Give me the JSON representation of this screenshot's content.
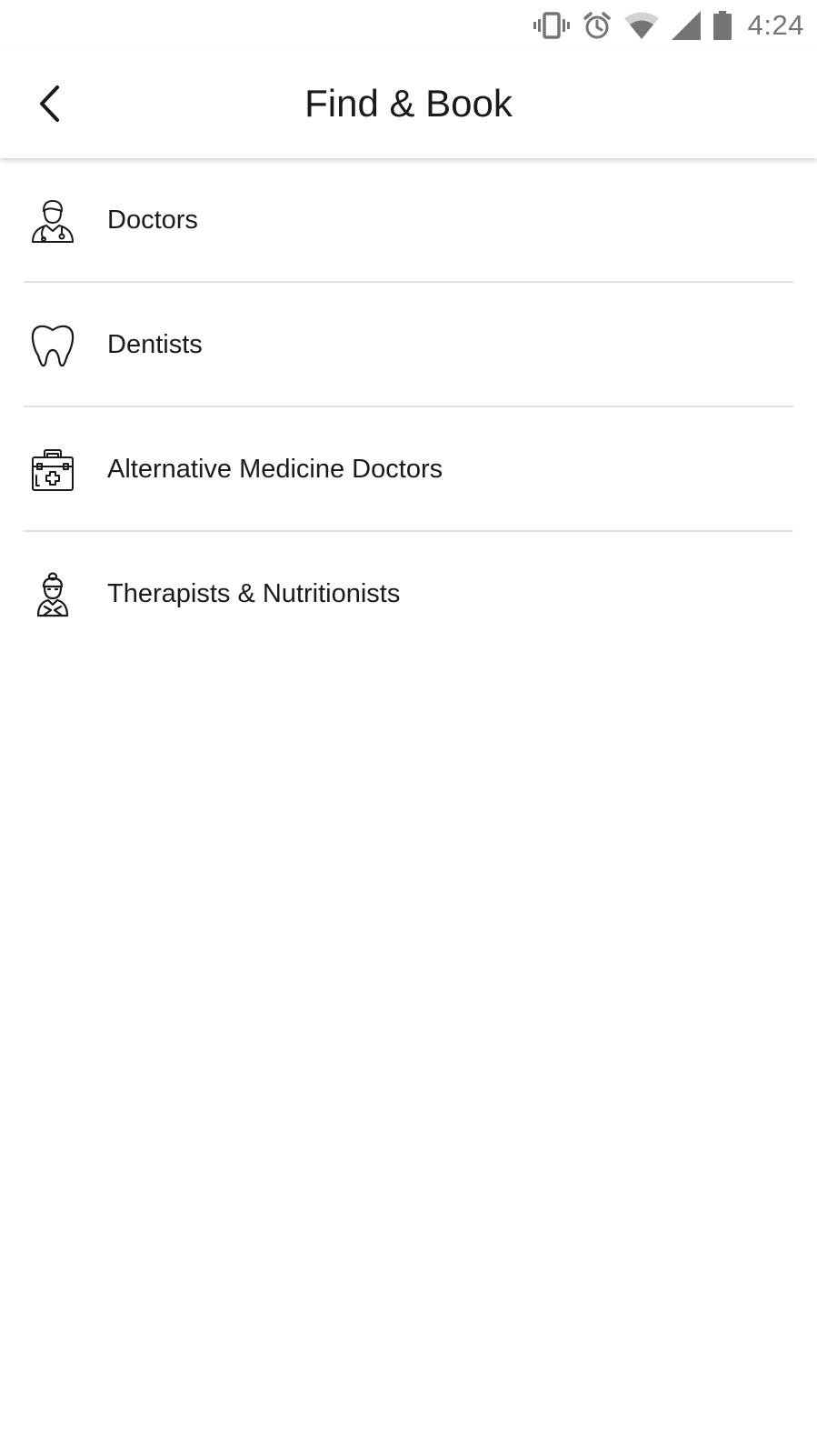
{
  "status_bar": {
    "time": "4:24",
    "icons": [
      "vibrate-icon",
      "alarm-icon",
      "wifi-icon",
      "cell-signal-icon",
      "battery-icon"
    ]
  },
  "header": {
    "title": "Find & Book",
    "back_icon": "chevron-left-icon"
  },
  "categories": [
    {
      "label": "Doctors",
      "icon": "doctor-icon"
    },
    {
      "label": "Dentists",
      "icon": "tooth-icon"
    },
    {
      "label": "Alternative Medicine Doctors",
      "icon": "medical-kit-icon"
    },
    {
      "label": "Therapists & Nutritionists",
      "icon": "therapist-icon"
    }
  ],
  "colors": {
    "text": "#1a1a1a",
    "status_text": "#757575",
    "divider": "#e1e1e1",
    "background": "#ffffff"
  }
}
